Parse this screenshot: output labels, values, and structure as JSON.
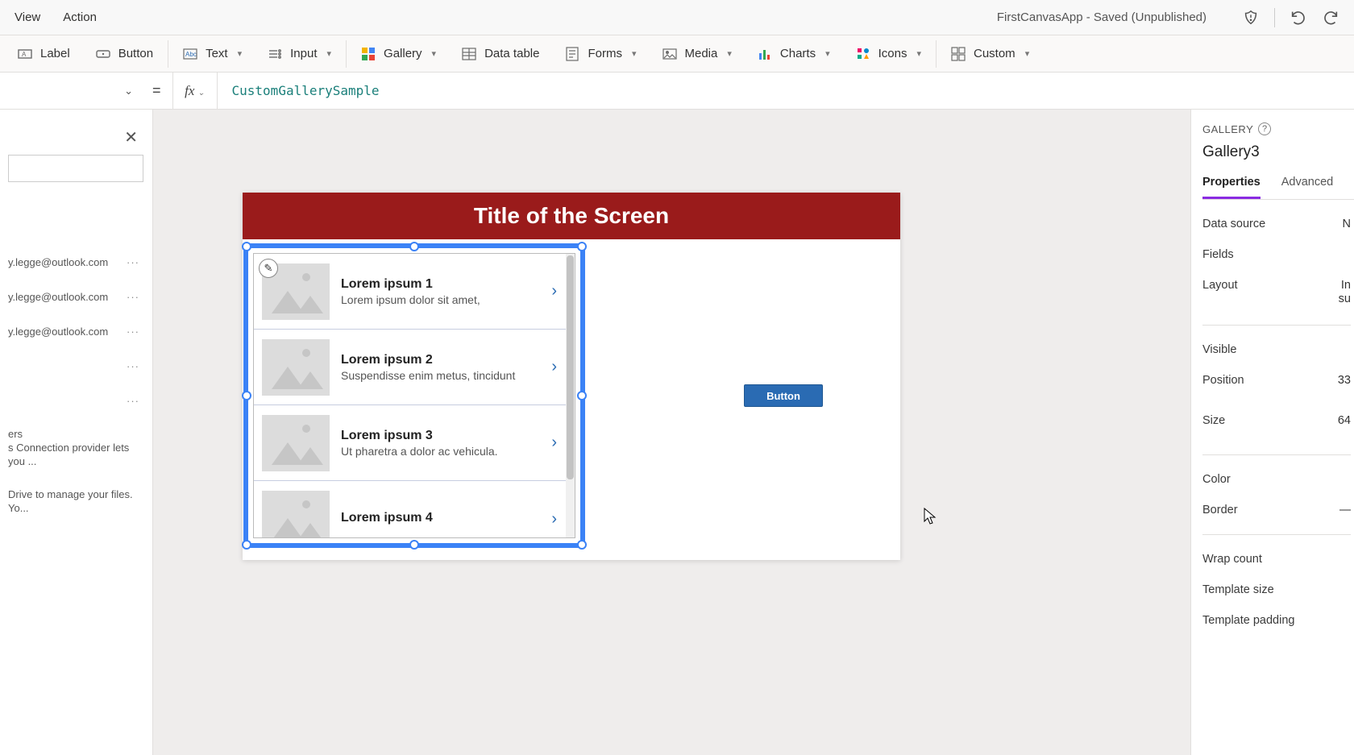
{
  "menubar": {
    "items": [
      "View",
      "Action"
    ],
    "app_status": "FirstCanvasApp - Saved (Unpublished)"
  },
  "ribbon": {
    "label": "Label",
    "button": "Button",
    "text": "Text",
    "input": "Input",
    "gallery": "Gallery",
    "datatable": "Data table",
    "forms": "Forms",
    "media": "Media",
    "charts": "Charts",
    "icons": "Icons",
    "custom": "Custom"
  },
  "formula": {
    "value": "CustomGallerySample"
  },
  "tree": {
    "emails": [
      "y.legge@outlook.com",
      "y.legge@outlook.com",
      "y.legge@outlook.com"
    ],
    "users_label": "ers",
    "users_desc": "s Connection provider lets you ...",
    "drive_desc": "Drive to manage your files. Yo..."
  },
  "canvas": {
    "screen_title": "Title of the Screen",
    "button_label": "Button",
    "gallery_items": [
      {
        "title": "Lorem ipsum 1",
        "sub": "Lorem ipsum dolor sit amet,"
      },
      {
        "title": "Lorem ipsum 2",
        "sub": "Suspendisse enim metus, tincidunt"
      },
      {
        "title": "Lorem ipsum 3",
        "sub": "Ut pharetra a dolor ac vehicula."
      },
      {
        "title": "Lorem ipsum 4",
        "sub": ""
      }
    ]
  },
  "properties": {
    "type": "GALLERY",
    "name": "Gallery3",
    "tabs": {
      "properties": "Properties",
      "advanced": "Advanced"
    },
    "rows": {
      "datasource": "Data source",
      "datasource_val": "N",
      "fields": "Fields",
      "layout": "Layout",
      "layout_val": "In",
      "layout_val2": "su",
      "visible": "Visible",
      "position": "Position",
      "position_val": "33",
      "size": "Size",
      "size_val": "64",
      "color": "Color",
      "border": "Border",
      "wrapcount": "Wrap count",
      "templatesize": "Template size",
      "templatepadding": "Template padding"
    }
  }
}
